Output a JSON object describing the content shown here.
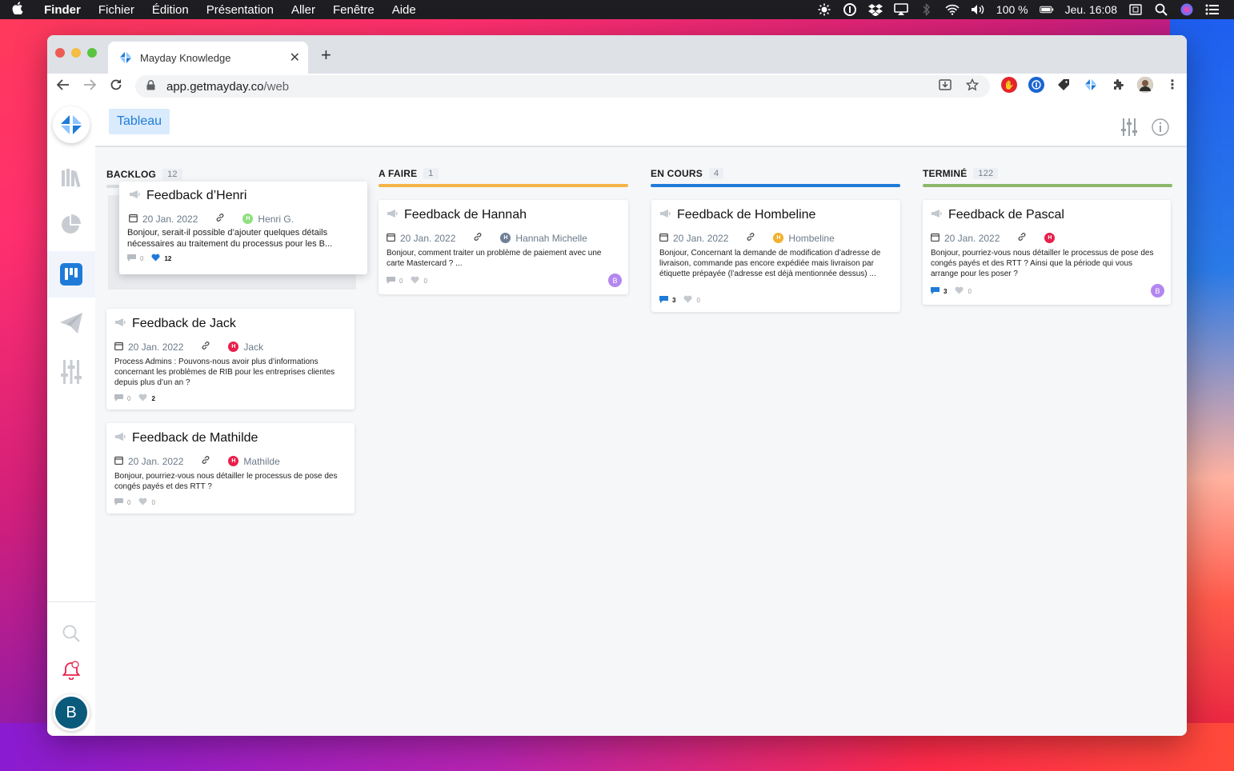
{
  "menubar": {
    "apple": "",
    "app_name": "Finder",
    "items": [
      "Fichier",
      "Édition",
      "Présentation",
      "Aller",
      "Fenêtre",
      "Aide"
    ],
    "battery": "100 %",
    "clock": "Jeu. 16:08"
  },
  "browser": {
    "tab_title": "Mayday Knowledge",
    "tab_close": "✕",
    "new_tab": "+",
    "url_host": "app.getmayday.co",
    "url_path": "/web"
  },
  "app": {
    "view_tab": "Tableau",
    "user_initial": "B",
    "columns": [
      {
        "title": "BACKLOG",
        "count": "12",
        "cards": [
          {
            "title": "Feedback d’Henri",
            "date": "20 Jan. 2022",
            "author": "Henri G.",
            "author_initial": "H",
            "author_color": "#8fe07f",
            "body": "Bonjour, serait-il possible d’ajouter quelques détails nécessaires au traitement du processus pour les B...",
            "comments": "0",
            "likes": "12"
          },
          {
            "title": "Feedback de Jack",
            "date": "20 Jan. 2022",
            "author": "Jack",
            "author_initial": "H",
            "author_color": "#e8204a",
            "body": "Process Admins : Pouvons-nous avoir plus d’informations concernant les problèmes de RIB pour les entreprises clientes depuis plus d’un an ?",
            "comments": "0",
            "likes": "2"
          },
          {
            "title": "Feedback de Mathilde",
            "date": "20 Jan. 2022",
            "author": "Mathilde",
            "author_initial": "H",
            "author_color": "#e8204a",
            "body": "Bonjour, pourriez-vous nous détailler le processus de pose des congés payés et des RTT ?",
            "comments": "0",
            "likes": "0"
          }
        ]
      },
      {
        "title": "A FAIRE",
        "count": "1",
        "color": "#f5b347",
        "cards": [
          {
            "title": "Feedback de Hannah",
            "date": "20 Jan. 2022",
            "author": "Hannah Michelle",
            "author_initial": "H",
            "author_color": "#6f8096",
            "body": "Bonjour, comment traiter un problème de paiement avec une carte Mastercard ? ...",
            "comments": "0",
            "likes": "0",
            "assignee": "B"
          }
        ]
      },
      {
        "title": "EN COURS",
        "count": "4",
        "color": "#1f7bd8",
        "cards": [
          {
            "title": "Feedback de Hombeline",
            "date": "20 Jan. 2022",
            "author": "Hombeline",
            "author_initial": "H",
            "author_color": "#f2b12c",
            "body": "Bonjour, Concernant la demande de modification d’adresse de livraison, commande pas encore expédiée mais livraison par étiquette prépayée (l’adresse est déjà mentionnée dessus) ...",
            "comments": "3",
            "likes": "0"
          }
        ]
      },
      {
        "title": "TERMINÉ",
        "count": "122",
        "color": "#8db86a",
        "cards": [
          {
            "title": "Feedback de Pascal",
            "date": "20 Jan. 2022",
            "author": "",
            "author_initial": "H",
            "author_color": "#e8204a",
            "body": "Bonjour, pourriez-vous nous détailler le processus de pose des congés payés et des RTT ? Ainsi que la période qui vous arrange pour les poser ?",
            "comments": "3",
            "likes": "0",
            "assignee": "B"
          }
        ]
      }
    ]
  }
}
